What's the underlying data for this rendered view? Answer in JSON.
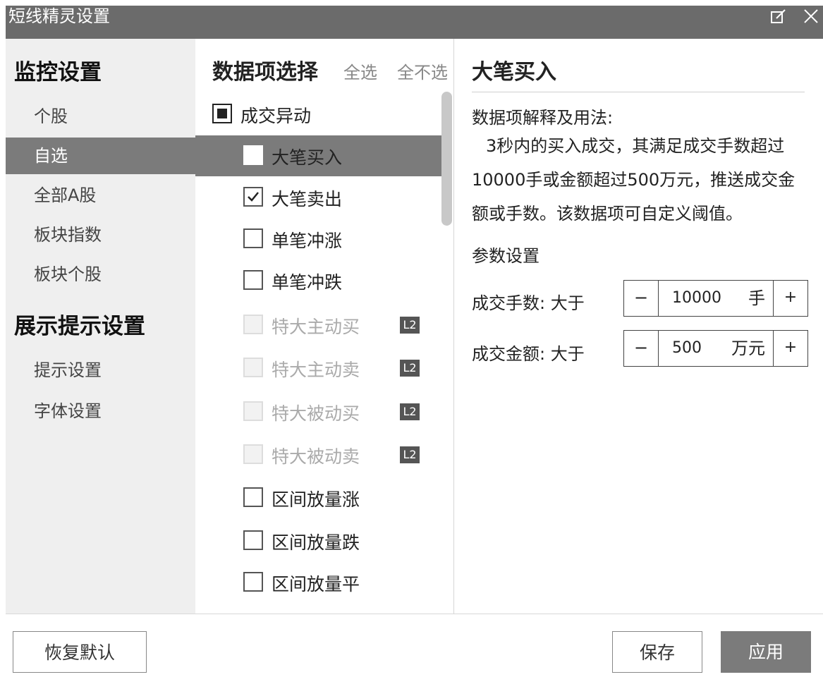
{
  "window": {
    "title": "短线精灵设置"
  },
  "nav": {
    "heading1": "监控设置",
    "items1": [
      "个股",
      "自选",
      "全部A股",
      "板块指数",
      "板块个股"
    ],
    "heading2": "展示提示设置",
    "items2": [
      "提示设置",
      "字体设置"
    ],
    "active": "自选"
  },
  "data_items": {
    "title": "数据项选择",
    "select_all": "全选",
    "select_none": "全不选",
    "group_label": "成交异动",
    "items": [
      {
        "label": "大笔买入",
        "checked": false,
        "disabled": false,
        "selected": true,
        "badge": ""
      },
      {
        "label": "大笔卖出",
        "checked": true,
        "disabled": false,
        "selected": false,
        "badge": ""
      },
      {
        "label": "单笔冲涨",
        "checked": false,
        "disabled": false,
        "selected": false,
        "badge": ""
      },
      {
        "label": "单笔冲跌",
        "checked": false,
        "disabled": false,
        "selected": false,
        "badge": ""
      },
      {
        "label": "特大主动买",
        "checked": false,
        "disabled": true,
        "selected": false,
        "badge": "L2"
      },
      {
        "label": "特大主动卖",
        "checked": false,
        "disabled": true,
        "selected": false,
        "badge": "L2"
      },
      {
        "label": "特大被动买",
        "checked": false,
        "disabled": true,
        "selected": false,
        "badge": "L2"
      },
      {
        "label": "特大被动卖",
        "checked": false,
        "disabled": true,
        "selected": false,
        "badge": "L2"
      },
      {
        "label": "区间放量涨",
        "checked": false,
        "disabled": false,
        "selected": false,
        "badge": ""
      },
      {
        "label": "区间放量跌",
        "checked": false,
        "disabled": false,
        "selected": false,
        "badge": ""
      },
      {
        "label": "区间放量平",
        "checked": false,
        "disabled": false,
        "selected": false,
        "badge": ""
      }
    ]
  },
  "detail": {
    "title": "大笔买入",
    "explain_label": "数据项解释及用法:",
    "description": "3秒内的买入成交，其满足成交手数超过10000手或金额超过500万元，推送成交金额或手数。该数据项可自定义阈值。",
    "params_label": "参数设置",
    "params": [
      {
        "label": "成交手数: 大于",
        "value": "10000",
        "unit": "手",
        "minus": "−",
        "plus": "+"
      },
      {
        "label": "成交金额: 大于",
        "value": "500",
        "unit": "万元",
        "minus": "−",
        "plus": "+"
      }
    ]
  },
  "footer": {
    "restore": "恢复默认",
    "save": "保存",
    "apply": "应用"
  },
  "icons": {
    "edit": "edit-icon",
    "close": "close-icon",
    "check": "check-icon"
  }
}
